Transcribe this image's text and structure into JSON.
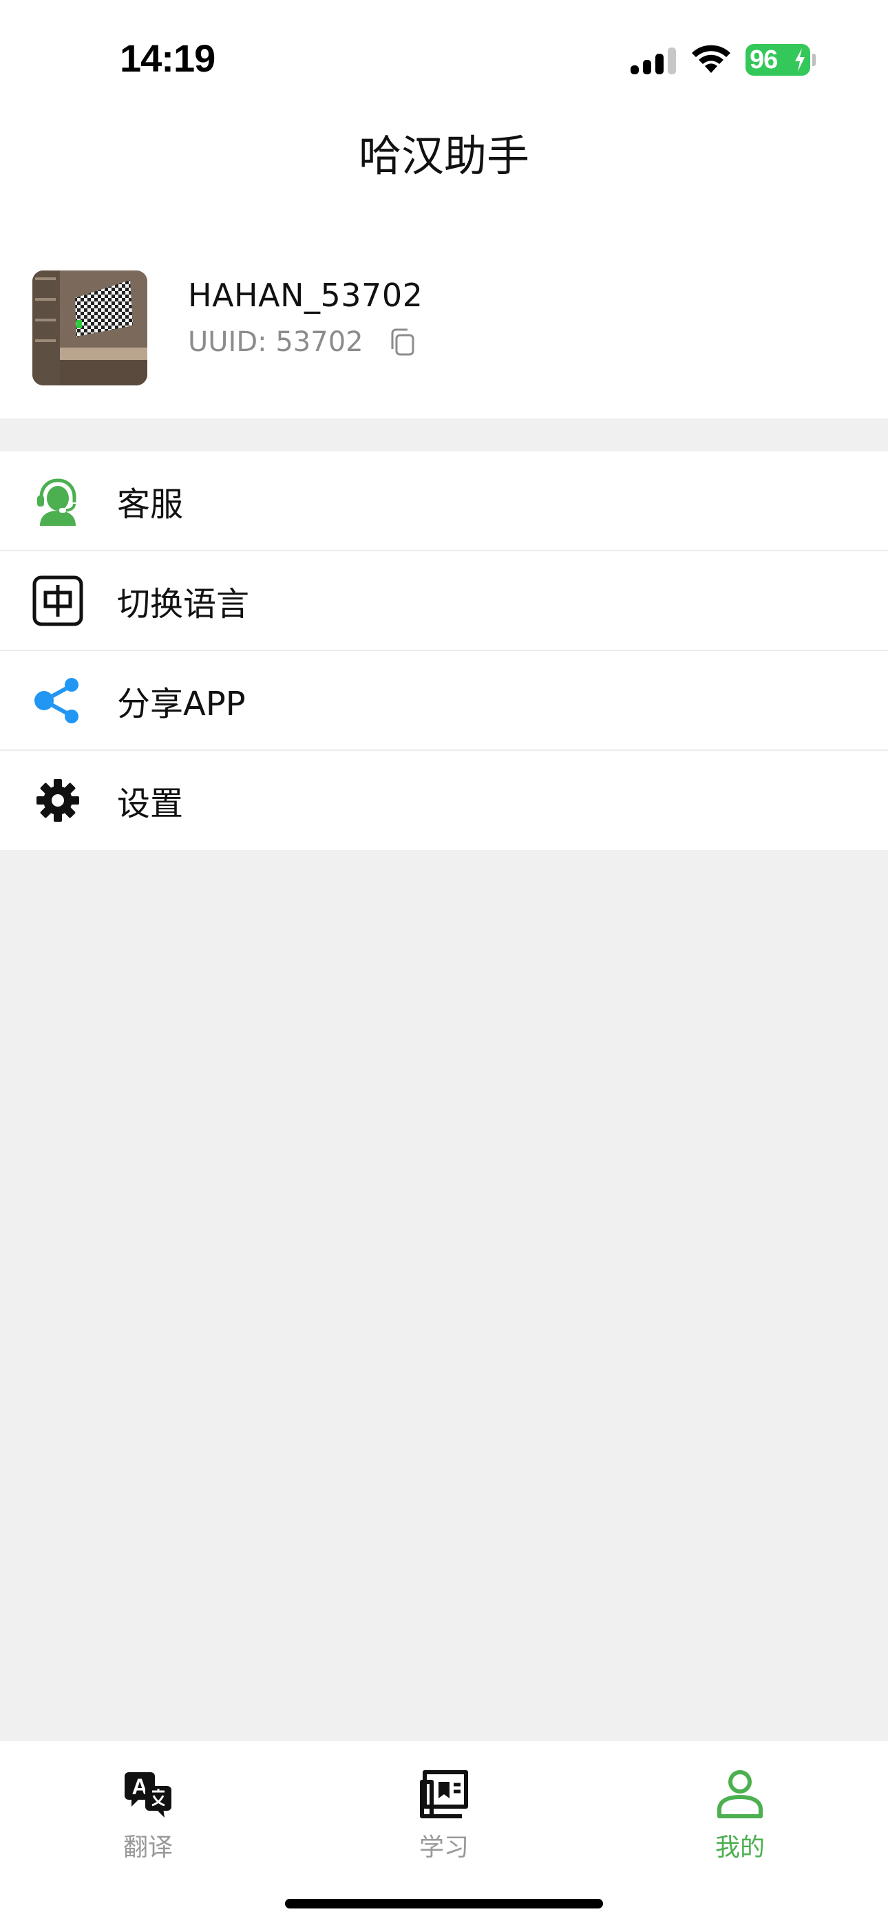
{
  "status_bar": {
    "time": "14:19",
    "battery": "96",
    "signal_icon": "cellular-signal-icon",
    "wifi_icon": "wifi-icon",
    "battery_color": "#34c759"
  },
  "header": {
    "title": "哈汉助手"
  },
  "profile": {
    "username": "HAHAN_53702",
    "uuid_label": "UUID: 53702",
    "copy_icon": "copy-icon"
  },
  "menu": {
    "items": [
      {
        "label": "客服",
        "icon": "customer-service-icon",
        "color": "#4caf50"
      },
      {
        "label": "切换语言",
        "icon": "language-icon",
        "color": "#111111"
      },
      {
        "label": "分享APP",
        "icon": "share-icon",
        "color": "#2196f3"
      },
      {
        "label": "设置",
        "icon": "gear-icon",
        "color": "#111111"
      }
    ]
  },
  "tab_bar": {
    "tabs": [
      {
        "label": "翻译",
        "icon": "translate-icon",
        "active": false
      },
      {
        "label": "学习",
        "icon": "study-icon",
        "active": false
      },
      {
        "label": "我的",
        "icon": "person-icon",
        "active": true
      }
    ],
    "active_color": "#4caf50",
    "inactive_color": "#999999"
  }
}
